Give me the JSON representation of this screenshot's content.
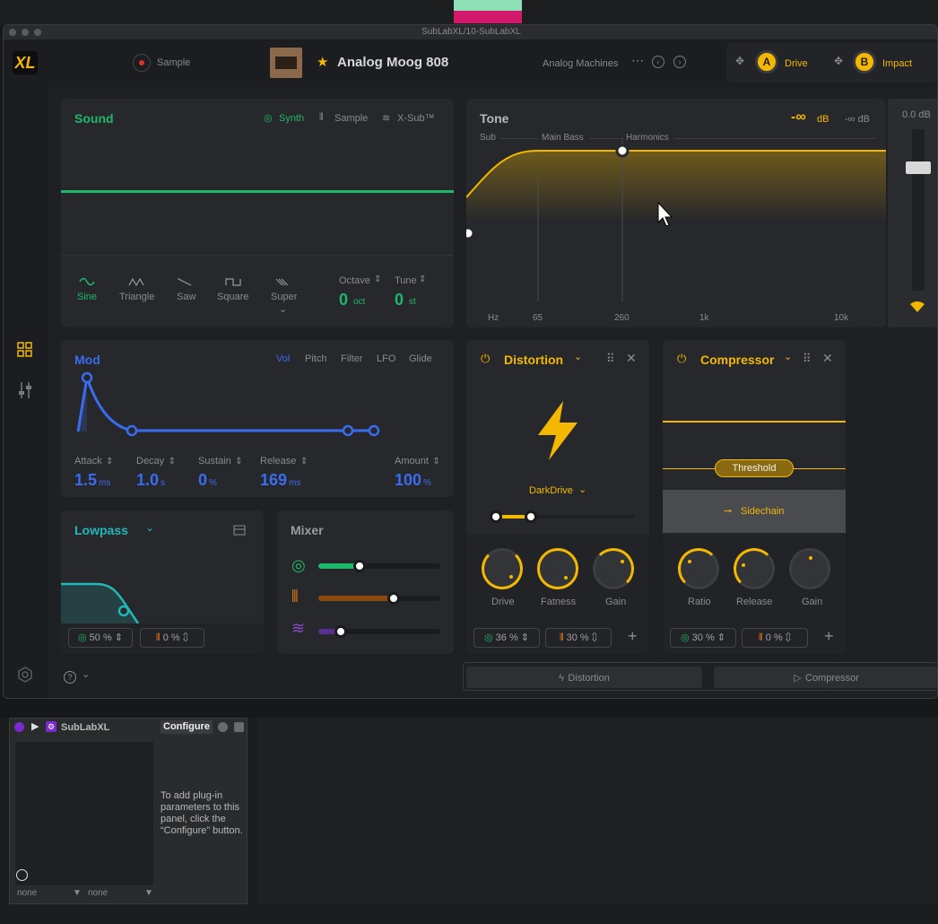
{
  "window": {
    "title": "SubLabXL/10-SubLabXL"
  },
  "header": {
    "logo": "XL",
    "sample_label": "Sample",
    "preset_name": "Analog Moog 808",
    "preset_bank": "Analog Machines",
    "macro_a_letter": "A",
    "macro_a_label": "Drive",
    "macro_b_letter": "B",
    "macro_b_label": "Impact"
  },
  "sound": {
    "title": "Sound",
    "tabs": [
      "Synth",
      "Sample",
      "X-Sub™"
    ],
    "waves": [
      "Sine",
      "Triangle",
      "Saw",
      "Square",
      "Super"
    ],
    "octave_label": "Octave",
    "octave_value": "0",
    "octave_unit": "oct",
    "tune_label": "Tune",
    "tune_value": "0",
    "tune_unit": "st"
  },
  "tone": {
    "title": "Tone",
    "db_value": "-∞",
    "db_unit": "dB",
    "db_alt": "-∞ dB",
    "bands": [
      "Sub",
      "Main Bass",
      "Harmonics"
    ],
    "freqs": [
      "Hz",
      "65",
      "260",
      "1k",
      "10k"
    ]
  },
  "meter": {
    "label": "0.0 dB"
  },
  "mod": {
    "title": "Mod",
    "tabs": [
      "Vol",
      "Pitch",
      "Filter",
      "LFO",
      "Glide"
    ],
    "params": [
      {
        "label": "Attack",
        "value": "1.5",
        "unit": "ms"
      },
      {
        "label": "Decay",
        "value": "1.0",
        "unit": "s"
      },
      {
        "label": "Sustain",
        "value": "0",
        "unit": "%"
      },
      {
        "label": "Release",
        "value": "169",
        "unit": "ms"
      },
      {
        "label": "Amount",
        "value": "100",
        "unit": "%"
      }
    ]
  },
  "filter": {
    "title": "Lowpass",
    "left_value": "50 %",
    "right_value": "0 %"
  },
  "mixer": {
    "title": "Mixer"
  },
  "distortion": {
    "title": "Distortion",
    "type": "DarkDrive",
    "knobs": [
      "Drive",
      "Fatness",
      "Gain"
    ],
    "left_value": "36 %",
    "right_value": "30 %"
  },
  "compressor": {
    "title": "Compressor",
    "threshold": "Threshold",
    "sidechain": "Sidechain",
    "knobs": [
      "Ratio",
      "Release",
      "Gain"
    ],
    "left_value": "30 %",
    "right_value": "0 %"
  },
  "fx_tabs": [
    "Distortion",
    "Compressor"
  ],
  "bottom": {
    "device_name": "SubLabXL",
    "configure": "Configure",
    "help_text": "To add plug-in parameters to this panel, click the “Configure” button.",
    "select_left": "none",
    "select_right": "none"
  },
  "colors": {
    "green": "#1fb86a",
    "blue": "#3a6cf0",
    "yellow": "#f5b800",
    "teal": "#23b8b8"
  }
}
